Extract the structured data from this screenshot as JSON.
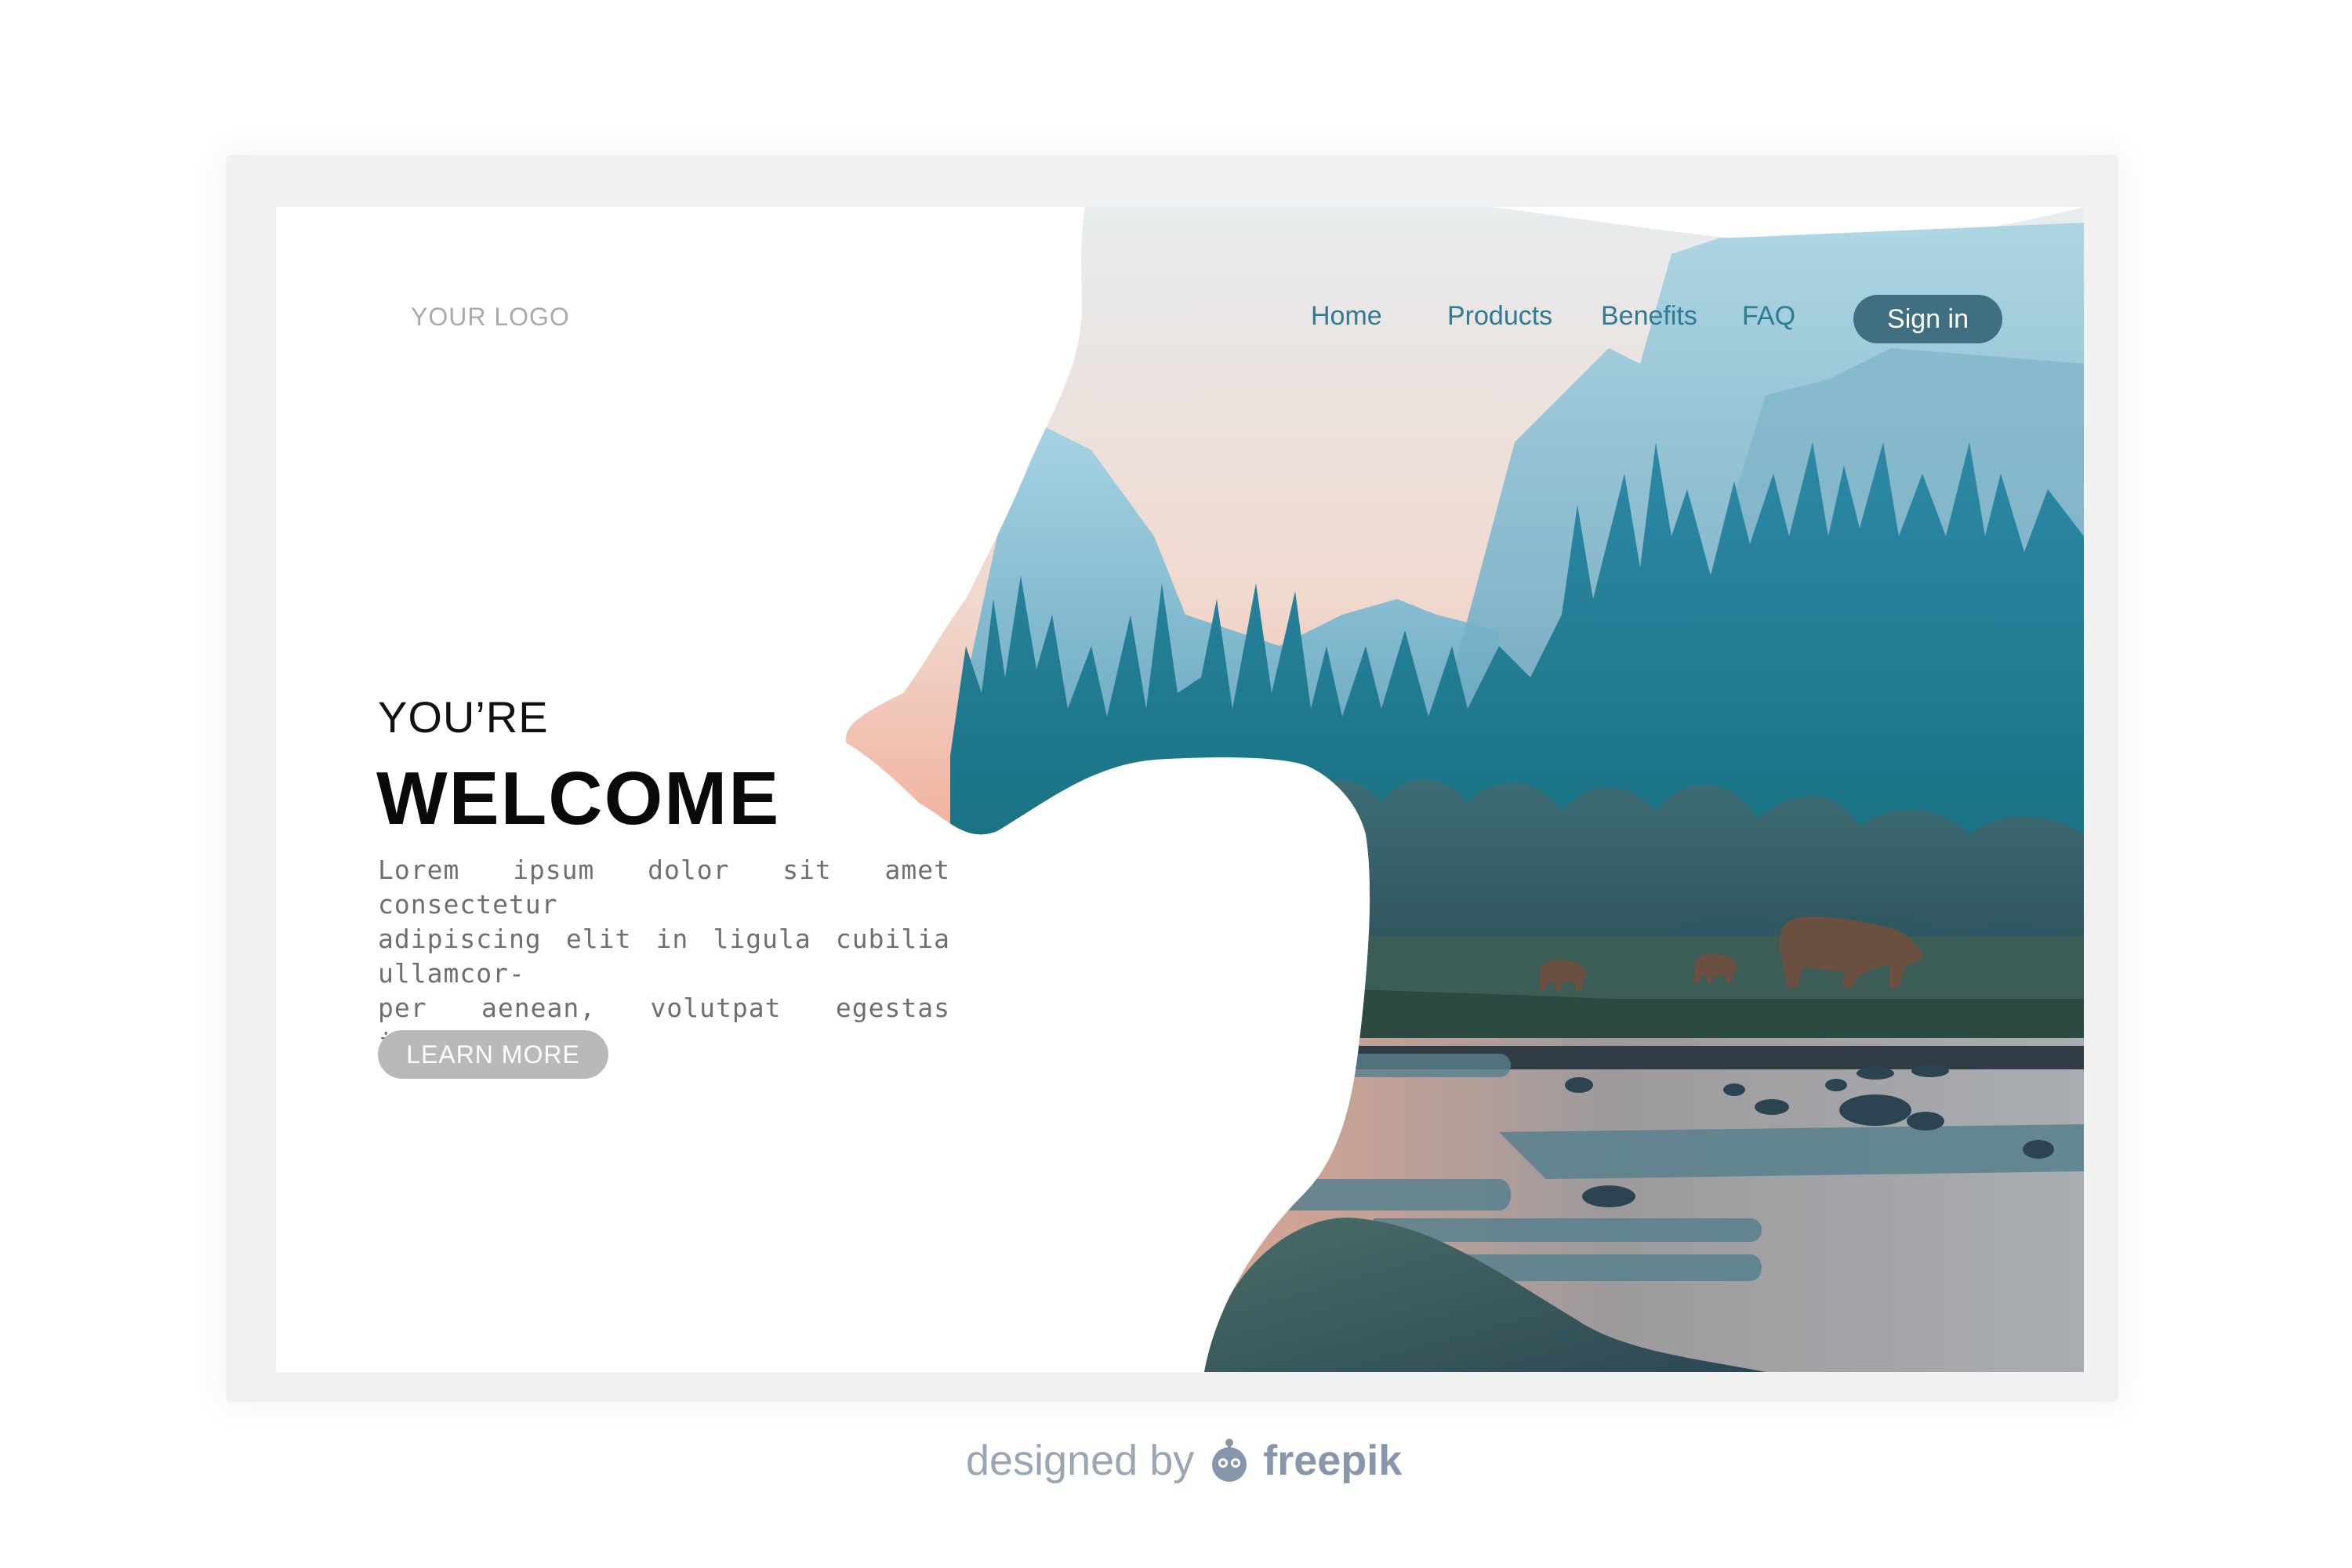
{
  "header": {
    "logo_text": "YOUR LOGO",
    "nav": [
      "Home",
      "Products",
      "Benefits",
      "FAQ"
    ],
    "signin_label": "Sign in"
  },
  "hero": {
    "subtitle": "YOU’RE",
    "title": "WELCOME",
    "body_lines": [
      "Lorem ipsum dolor sit amet consectetur",
      "adipiscing elit in ligula cubilia ullamcor-",
      "per aenean, volutpat egestas imperdiet"
    ],
    "cta_label": "LEARN MORE"
  },
  "illustration": {
    "subject": "bear-silhouette-landscape",
    "icons": [
      "bear-icon",
      "pine-tree-icon",
      "mountain-icon",
      "river-icon",
      "rock-icon"
    ]
  },
  "footer": {
    "credit_prefix": "designed by",
    "credit_brand": "freepik"
  },
  "colors": {
    "accent": "#3f6f80",
    "nav_text": "#2f7c92",
    "cta_bg": "#b9b9b9"
  }
}
